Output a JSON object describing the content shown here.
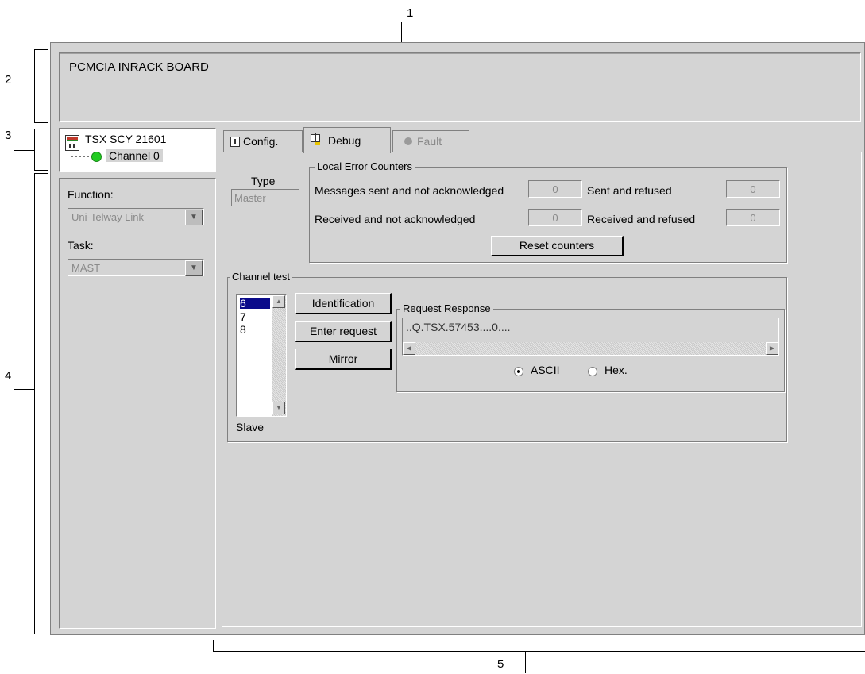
{
  "callouts": {
    "c1": "1",
    "c2": "2",
    "c3": "3",
    "c4": "4",
    "c5": "5"
  },
  "header": {
    "title": "PCMCIA INRACK BOARD"
  },
  "module": {
    "name": "TSX SCY 21601",
    "channel": "Channel 0",
    "status_color": "#22cc22"
  },
  "left_panel": {
    "function_label": "Function:",
    "function_value": "Uni-Telway Link",
    "task_label": "Task:",
    "task_value": "MAST"
  },
  "tabs": [
    {
      "label": "Config."
    },
    {
      "label": "Debug"
    },
    {
      "label": "Fault"
    }
  ],
  "type": {
    "label": "Type",
    "value": "Master"
  },
  "local_error_counters": {
    "title": "Local Error Counters",
    "msg_sent_label": "Messages sent and not acknowledged",
    "msg_sent_value": "0",
    "sent_refused_label": "Sent and refused",
    "sent_refused_value": "0",
    "received_label": "Received and not acknowledged",
    "received_value": "0",
    "received_refused_label": "Received and refused",
    "received_refused_value": "0",
    "reset_button": "Reset counters"
  },
  "channel_test": {
    "title": "Channel test",
    "slave_items": [
      "6",
      "7",
      "8"
    ],
    "slave_label": "Slave",
    "identification_button": "Identification",
    "enter_request_button": "Enter request",
    "mirror_button": "Mirror",
    "request_response_title": "Request Response",
    "response_text": "..Q.TSX.57453....0....",
    "ascii_label": "ASCII",
    "hex_label": "Hex.",
    "selected_format": "ASCII"
  },
  "colors": {
    "window_bg": "#d4d4d4",
    "selection": "#0a0a8a"
  }
}
